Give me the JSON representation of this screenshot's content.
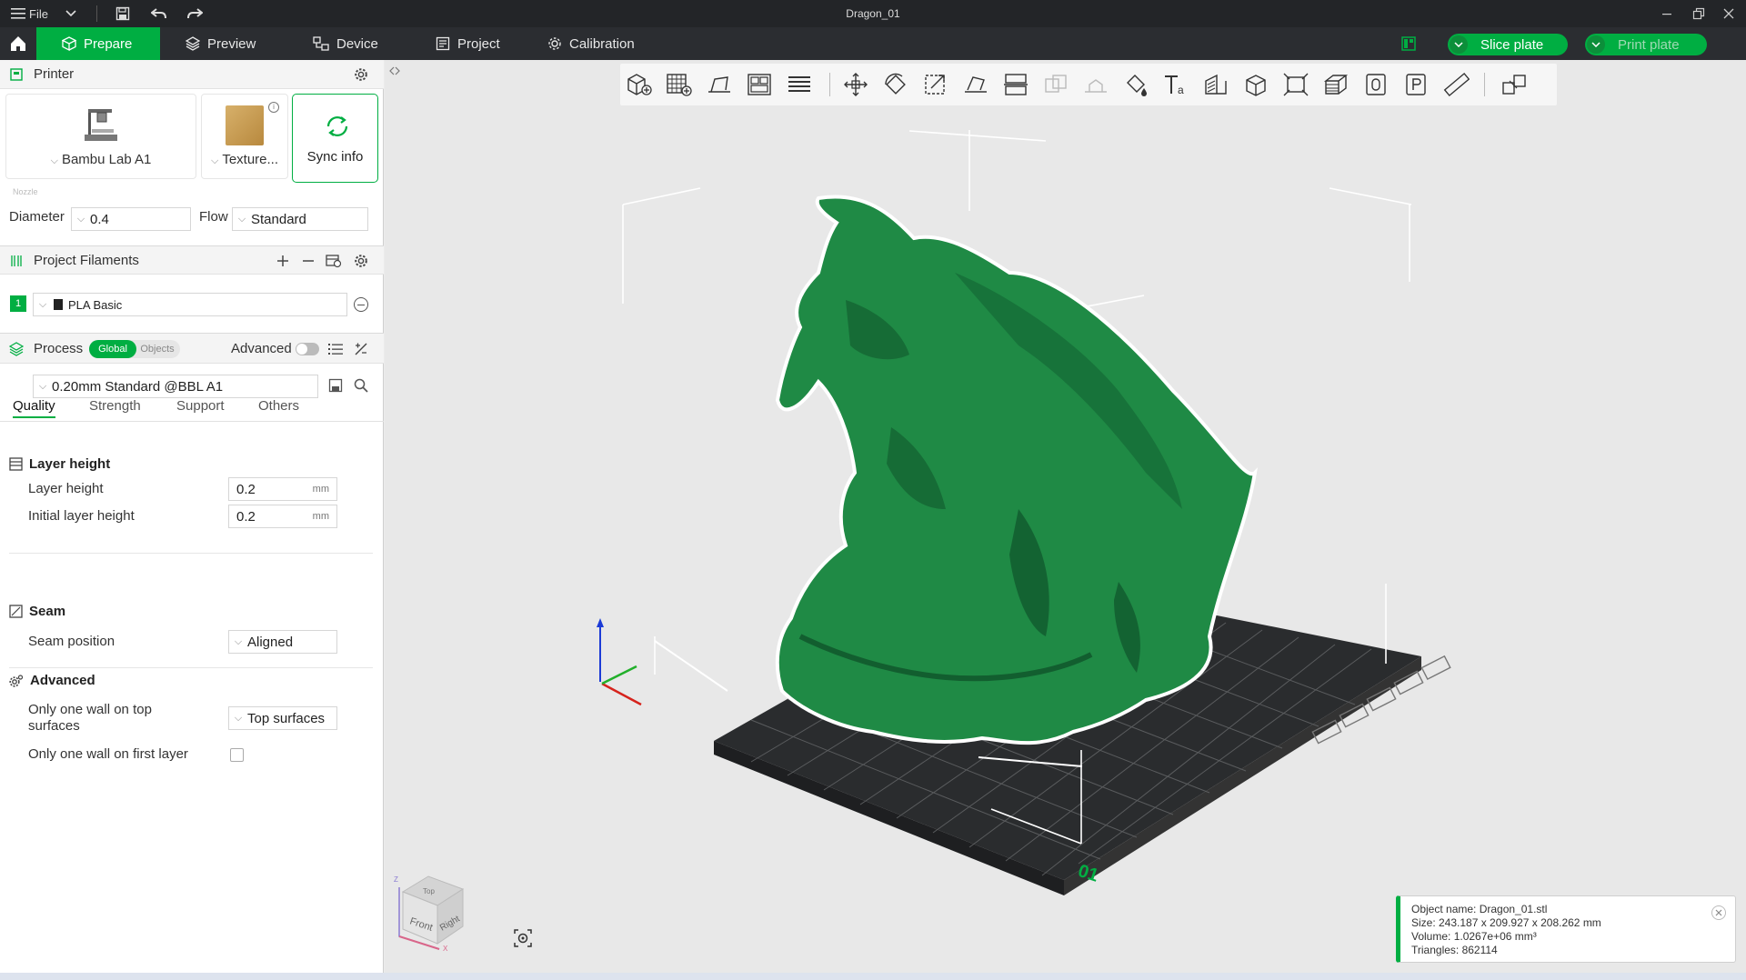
{
  "titlebar": {
    "file_label": "File",
    "doc_title": "Dragon_01",
    "icons": [
      "menu-icon",
      "chevron-down-icon",
      "save-icon",
      "undo-icon",
      "redo-icon",
      "minimize-icon",
      "restore-icon",
      "close-icon"
    ]
  },
  "nav": {
    "tabs": [
      {
        "label": "Prepare",
        "icon": "cube-icon",
        "active": true
      },
      {
        "label": "Preview",
        "icon": "layers-icon",
        "active": false
      },
      {
        "label": "Device",
        "icon": "device-icon",
        "active": false
      },
      {
        "label": "Project",
        "icon": "document-icon",
        "active": false
      },
      {
        "label": "Calibration",
        "icon": "gear-icon",
        "active": false
      }
    ],
    "slice_label": "Slice plate",
    "print_label": "Print plate"
  },
  "printer": {
    "header": "Printer",
    "printer_name": "Bambu Lab A1",
    "plate_name": "Texture...",
    "sync_label": "Sync info",
    "nozzle_caption": "Nozzle",
    "diameter_label": "Diameter",
    "diameter_value": "0.4",
    "flow_label": "Flow",
    "flow_value": "Standard"
  },
  "filaments": {
    "header": "Project Filaments",
    "items": [
      {
        "index": "1",
        "name": "PLA Basic",
        "color": "#00ae42"
      }
    ]
  },
  "process": {
    "header": "Process",
    "global_label": "Global",
    "objects_label": "Objects",
    "advanced_label": "Advanced",
    "preset": "0.20mm Standard @BBL A1",
    "tabs": [
      "Quality",
      "Strength",
      "Support",
      "Others"
    ],
    "groups": {
      "layer_height": {
        "title": "Layer height",
        "layer_height_label": "Layer height",
        "layer_height_value": "0.2",
        "initial_layer_label": "Initial layer height",
        "initial_layer_value": "0.2",
        "unit": "mm"
      },
      "seam": {
        "title": "Seam",
        "position_label": "Seam position",
        "position_value": "Aligned"
      },
      "advanced": {
        "title": "Advanced",
        "one_wall_top_label": "Only one wall on top surfaces",
        "one_wall_top_value": "Top surfaces",
        "one_wall_first_label": "Only one wall on first layer",
        "one_wall_first_checked": false
      }
    }
  },
  "viewport": {
    "plate_label": "01",
    "view_cube": {
      "front": "Front",
      "right": "Right",
      "top": "Top",
      "z": "Z",
      "x": "X"
    },
    "model_color": "#1f8a45",
    "object_info": {
      "name": "Object name: Dragon_01.stl",
      "size": "Size: 243.187 x 209.927 x 208.262 mm",
      "volume": "Volume: 1.0267e+06 mm³",
      "triangles": "Triangles: 862114"
    }
  },
  "colors": {
    "accent": "#00ae42",
    "dark": "#2b2d31",
    "titlebar": "#232528"
  }
}
